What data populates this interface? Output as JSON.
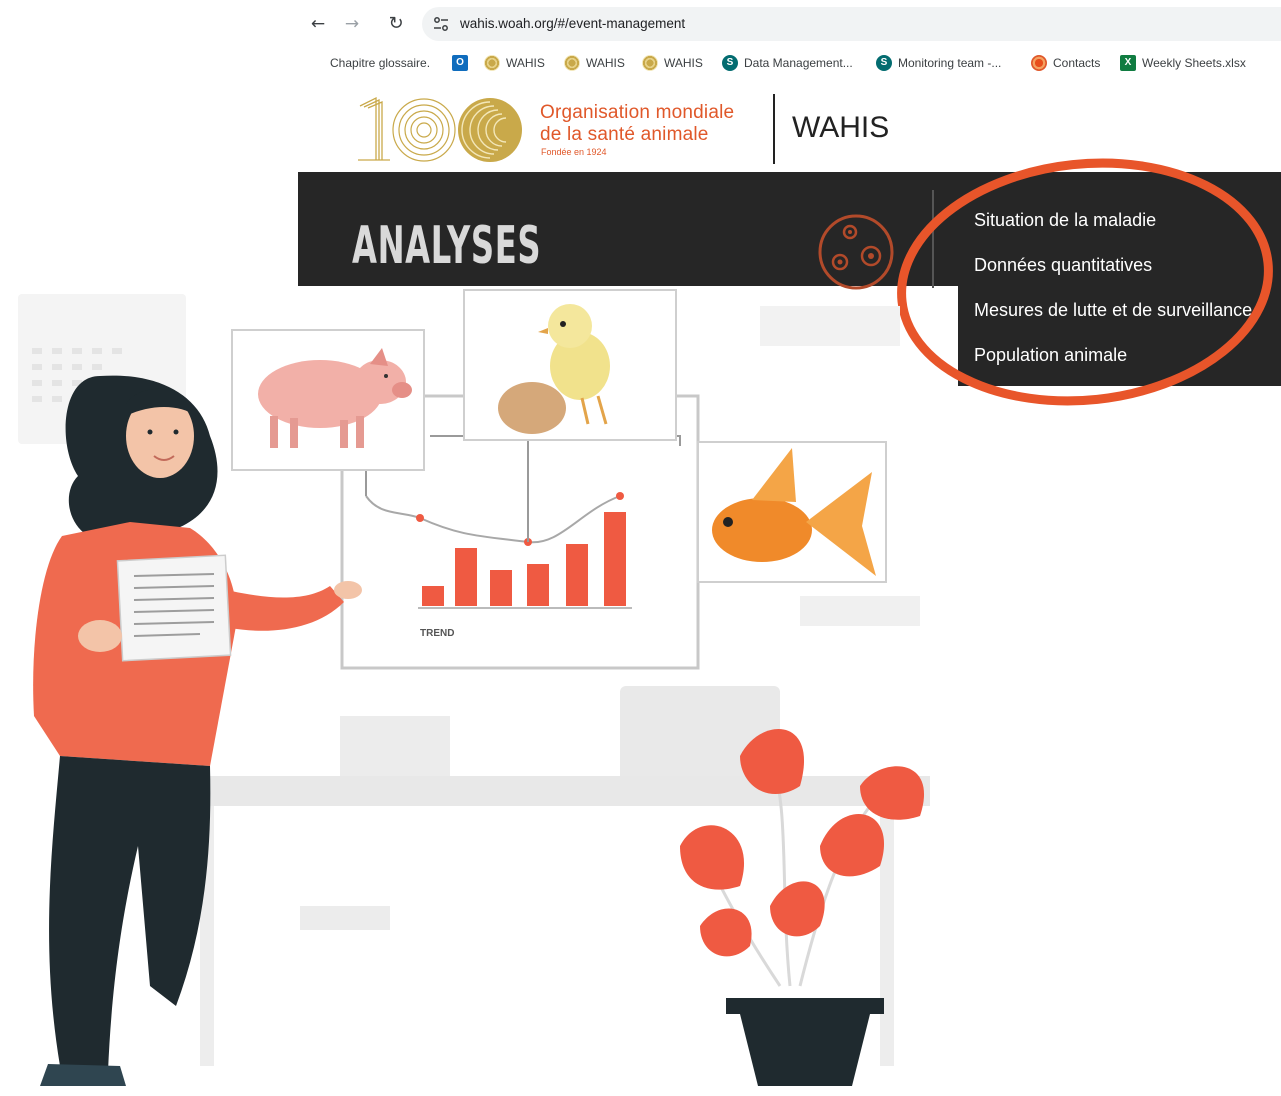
{
  "browser": {
    "url": "wahis.woah.org/#/event-management",
    "bookmarks": [
      {
        "label": "Chapitre glossaire.",
        "icon": "none"
      },
      {
        "label": "",
        "icon": "outlook-icon"
      },
      {
        "label": "WAHIS",
        "icon": "woah-icon"
      },
      {
        "label": "WAHIS",
        "icon": "woah-icon"
      },
      {
        "label": "WAHIS",
        "icon": "woah-icon"
      },
      {
        "label": "Data Management...",
        "icon": "sharepoint-icon"
      },
      {
        "label": "Monitoring team -...",
        "icon": "sharepoint-icon"
      },
      {
        "label": "Contacts",
        "icon": "contacts-icon"
      },
      {
        "label": "Weekly Sheets.xlsx",
        "icon": "excel-icon"
      }
    ]
  },
  "header": {
    "org_line1": "Organisation mondiale",
    "org_line2": "de la santé animale",
    "founded": "Fondée en 1924",
    "app_title": "WAHIS"
  },
  "banner": {
    "title": "ANALYSES"
  },
  "menu": {
    "items": [
      "Situation de la maladie",
      "Données quantitatives",
      "Mesures de lutte et de surveillance",
      "Population animale"
    ]
  },
  "illustration": {
    "chart_caption": "TREND"
  },
  "colors": {
    "accent": "#e0582a",
    "banner_bg": "#262626",
    "gold": "#c9a94a",
    "highlight": "#e8552a",
    "illustration_red": "#ef5a42"
  }
}
